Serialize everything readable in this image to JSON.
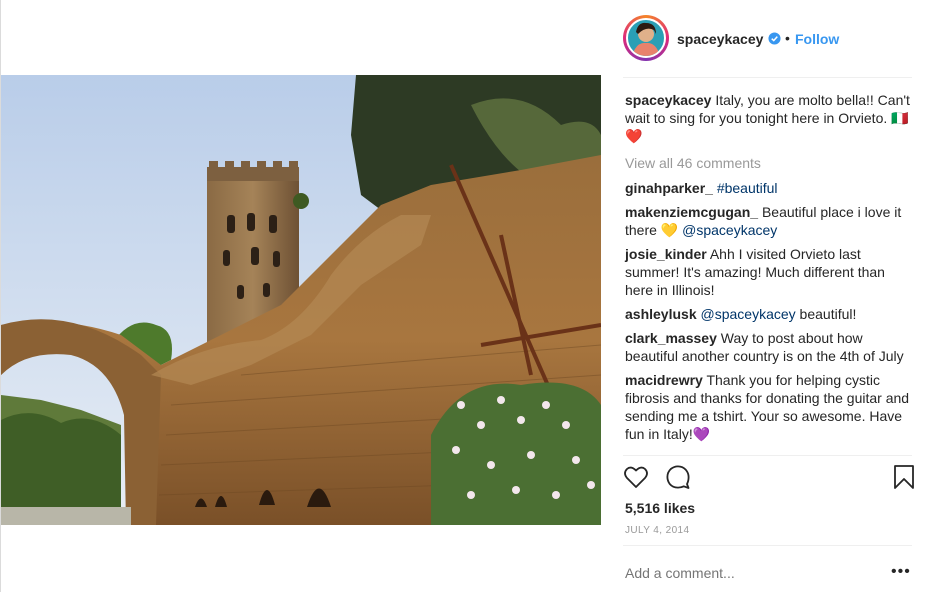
{
  "post": {
    "username": "spaceykacey",
    "follow_label": "Follow",
    "separator": "•",
    "caption": "Italy, you are molto bella!! Can't wait to sing for you tonight here in Orvieto.",
    "caption_emoji": "🇮🇹❤️",
    "view_all": "View all 46 comments",
    "likes": "5,516 likes",
    "date": "JULY 4, 2014",
    "add_comment_placeholder": "Add a comment...",
    "more_label": "•••"
  },
  "comments": [
    {
      "user": "ginahparker_",
      "text": "",
      "tag": "#beautiful",
      "rest": ""
    },
    {
      "user": "makenziemcgugan_",
      "text": "Beautiful place i love it there 💛",
      "tag": "@spaceykacey",
      "rest": ""
    },
    {
      "user": "josie_kinder",
      "text": "Ahh I visited Orvieto last summer! It's amazing! Much different than here in Illinois!",
      "tag": "",
      "rest": ""
    },
    {
      "user": "ashleylusk",
      "text": "",
      "tag": "@spaceykacey",
      "rest": "beautiful!"
    },
    {
      "user": "clark_massey",
      "text": "Way to post about how beautiful another country is on the 4th of July",
      "tag": "",
      "rest": ""
    },
    {
      "user": "macidrewry",
      "text": "Thank you for helping cystic fibrosis and thanks for donating the guitar and sending me a tshirt. Your so awesome. Have fun in Italy!💜",
      "tag": "",
      "rest": ""
    }
  ],
  "icons": {
    "like": "heart-icon",
    "comment": "comment-icon",
    "save": "bookmark-icon",
    "verified": "verified-badge-icon"
  },
  "colors": {
    "link": "#3897f0",
    "hashtag": "#003569",
    "muted": "#999999",
    "text": "#262626"
  }
}
